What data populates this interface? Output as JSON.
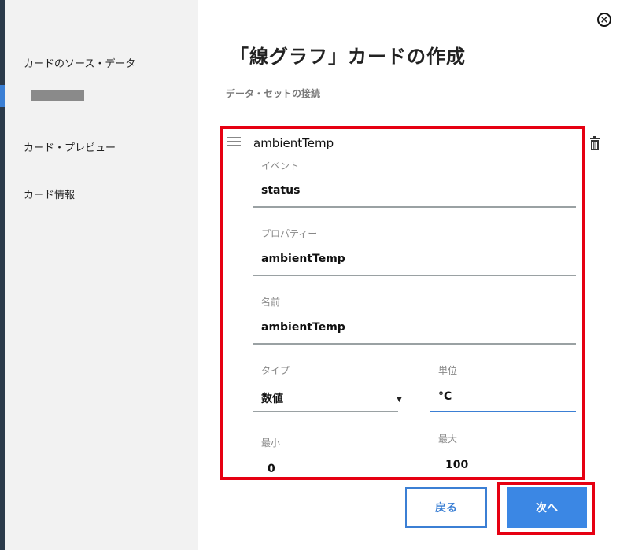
{
  "sidebar": {
    "items": [
      {
        "label": "カードのソース・データ"
      },
      {
        "label": "カード・プレビュー"
      },
      {
        "label": "カード情報"
      }
    ]
  },
  "dialog": {
    "title": "「線グラフ」カードの作成",
    "section_label": "データ・セットの接続",
    "close_icon": "close-circle-icon"
  },
  "series": {
    "name": "ambientTemp",
    "event": {
      "label": "イベント",
      "value": "status"
    },
    "property": {
      "label": "プロパティー",
      "value": "ambientTemp"
    },
    "display_name": {
      "label": "名前",
      "value": "ambientTemp"
    },
    "type": {
      "label": "タイプ",
      "value": "数値"
    },
    "unit": {
      "label": "単位",
      "value": "°C"
    },
    "min": {
      "label": "最小",
      "value": "0"
    },
    "max": {
      "label": "最大",
      "value": "100"
    }
  },
  "buttons": {
    "back": "戻る",
    "next": "次へ"
  },
  "colors": {
    "accent": "#3b7fd4",
    "highlight": "#e60012",
    "sidebar_bg": "#f2f2f2"
  }
}
